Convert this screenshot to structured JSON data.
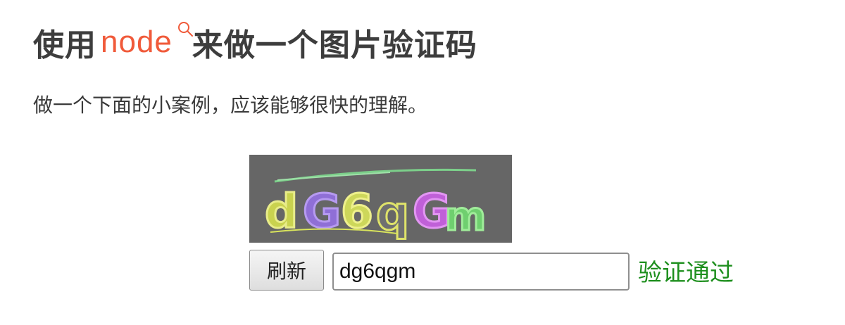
{
  "heading": {
    "prefix": "使用",
    "keyword": "node",
    "suffix": "来做一个图片验证码",
    "keyword_color": "#f05a3a",
    "keyword_icon": "search-icon"
  },
  "description": "做一个下面的小案例，应该能够很快的理解。",
  "captcha": {
    "text": "dG6qGm",
    "background": "#666666"
  },
  "refresh_button": {
    "label": "刷新"
  },
  "code_input": {
    "value": "dg6qgm"
  },
  "status": {
    "text": "验证通过",
    "color": "#1e8f1e"
  }
}
